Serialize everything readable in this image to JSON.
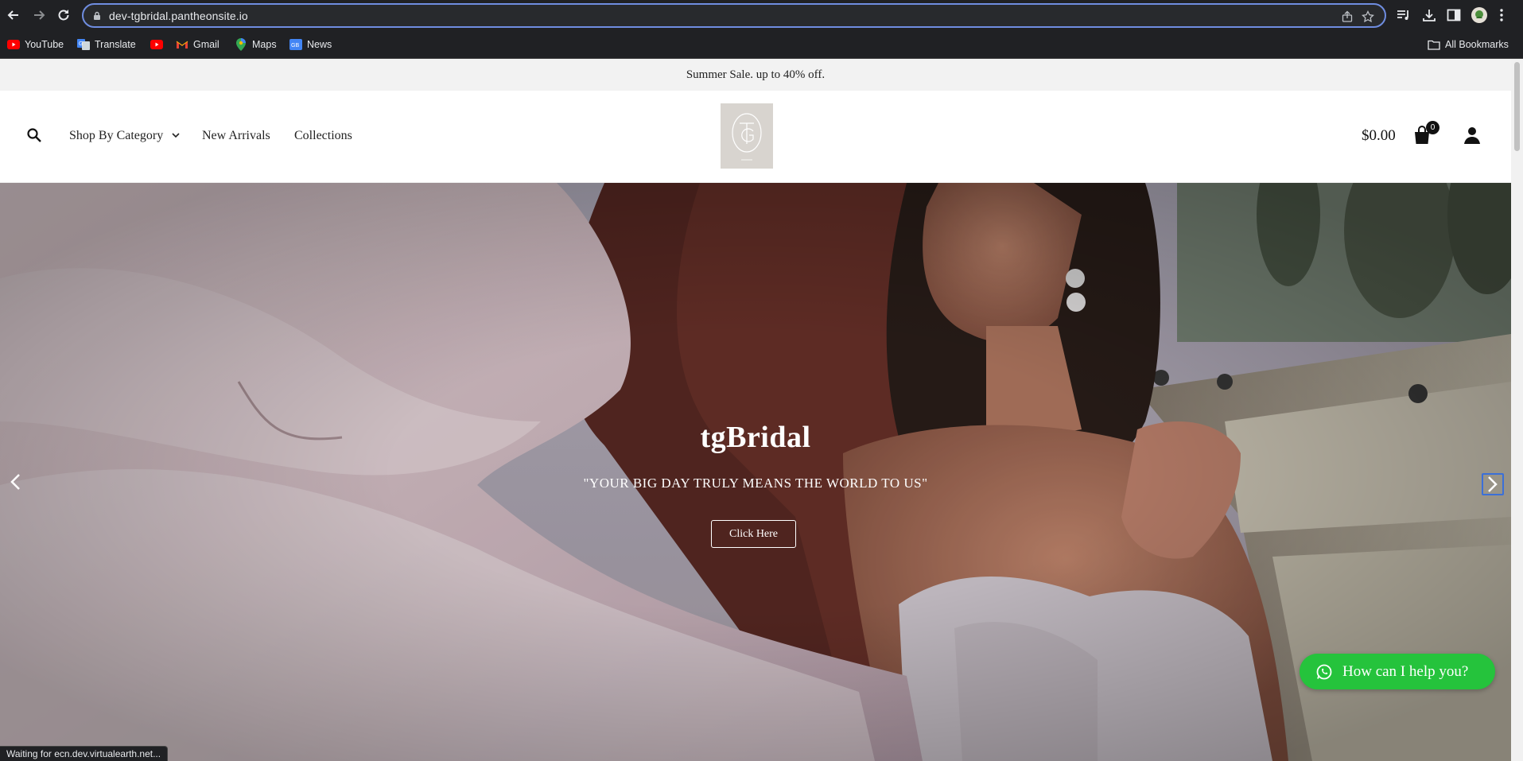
{
  "browser": {
    "url": "dev-tgbridal.pantheonsite.io",
    "bookmarks": [
      {
        "label": "YouTube",
        "icon": "youtube-icon"
      },
      {
        "label": "Translate",
        "icon": "translate-icon"
      },
      {
        "label": "",
        "icon": "youtube-icon"
      },
      {
        "label": "Gmail",
        "icon": "gmail-icon"
      },
      {
        "label": "Maps",
        "icon": "maps-icon"
      },
      {
        "label": "News",
        "icon": "news-icon"
      }
    ],
    "all_bookmarks_label": "All Bookmarks",
    "status_text": "Waiting for ecn.dev.virtualearth.net..."
  },
  "site": {
    "announcement": "Summer Sale. up to 40% off.",
    "menu": {
      "shop_by_category": "Shop By Category",
      "new_arrivals": "New Arrivals",
      "collections": "Collections"
    },
    "cart_amount": "$0.00",
    "cart_count": "0",
    "hero": {
      "title": "tgBridal",
      "subtitle": "\"YOUR BIG DAY TRULY MEANS THE WORLD TO US\"",
      "button": "Click Here"
    },
    "chat_label": "How can I help you?"
  },
  "colors": {
    "chrome_bg": "#202124",
    "omnibox_border": "#6f8de0",
    "announce_bg": "#f2f2f2",
    "chat_green": "#25c33c",
    "logo_bg": "#d8d4cf"
  }
}
